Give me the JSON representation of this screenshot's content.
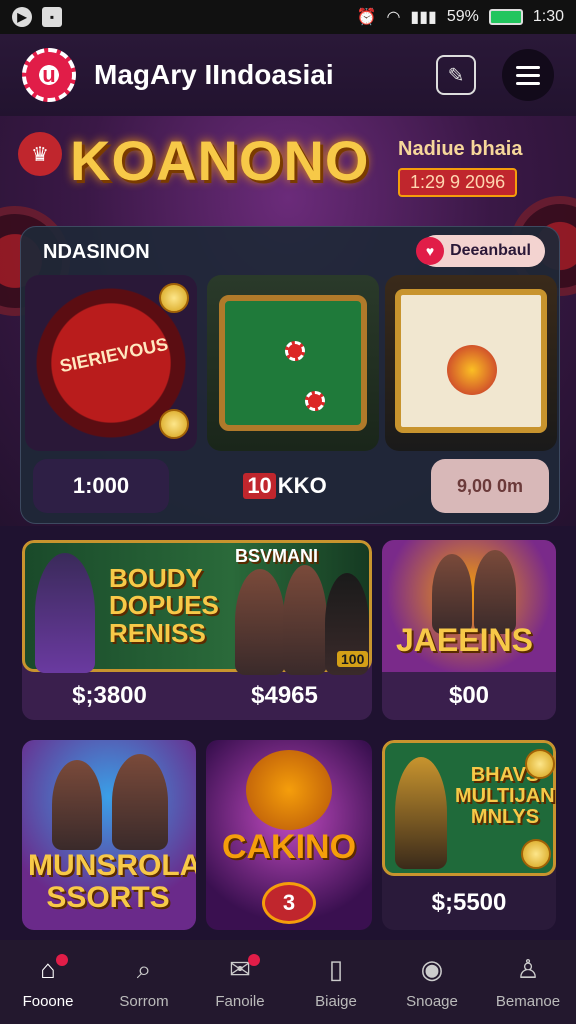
{
  "statusbar": {
    "battery": "1:30",
    "signal": "59%"
  },
  "header": {
    "title": "MagAry IIndoasiai"
  },
  "hero": {
    "title": "KOANONO",
    "subtitle": "Nadiue bhaia",
    "date": "1:29 9 2096"
  },
  "featured": {
    "title": "NDASINON",
    "tag": "Deeanbaul",
    "cards": [
      {
        "name": "SIERIEVOUS",
        "pill": "1:000"
      },
      {
        "name": "",
        "pill_badge": "10",
        "pill": "KKO"
      },
      {
        "name": "",
        "pill": "9,00 0m"
      }
    ]
  },
  "promos": [
    {
      "line1": "BOUDY DOPUES RENISS",
      "corner": "BSVMANI",
      "price": "$;3800",
      "price2": "$4965",
      "badge": "100"
    },
    {
      "title": "JAEEINS",
      "price": "$00"
    }
  ],
  "tiles": [
    {
      "title": "MUNSROLAS SSORTS"
    },
    {
      "title": "CAKINO",
      "button": "3"
    },
    {
      "title": "BHAVS MULTIJANIS MNLYS",
      "price": "$;5500"
    }
  ],
  "nav": [
    {
      "label": "Fooone",
      "icon": "home-icon",
      "badge": true
    },
    {
      "label": "Sorrom",
      "icon": "search-icon",
      "badge": false
    },
    {
      "label": "Fanoile",
      "icon": "chat-icon",
      "badge": true
    },
    {
      "label": "Biaige",
      "icon": "book-icon",
      "badge": false
    },
    {
      "label": "Snoage",
      "icon": "play-icon",
      "badge": false
    },
    {
      "label": "Bemanoe",
      "icon": "user-icon",
      "badge": false
    }
  ],
  "colors": {
    "accent": "#f7c948",
    "brand": "#c0262d",
    "bg": "#1f1230"
  }
}
